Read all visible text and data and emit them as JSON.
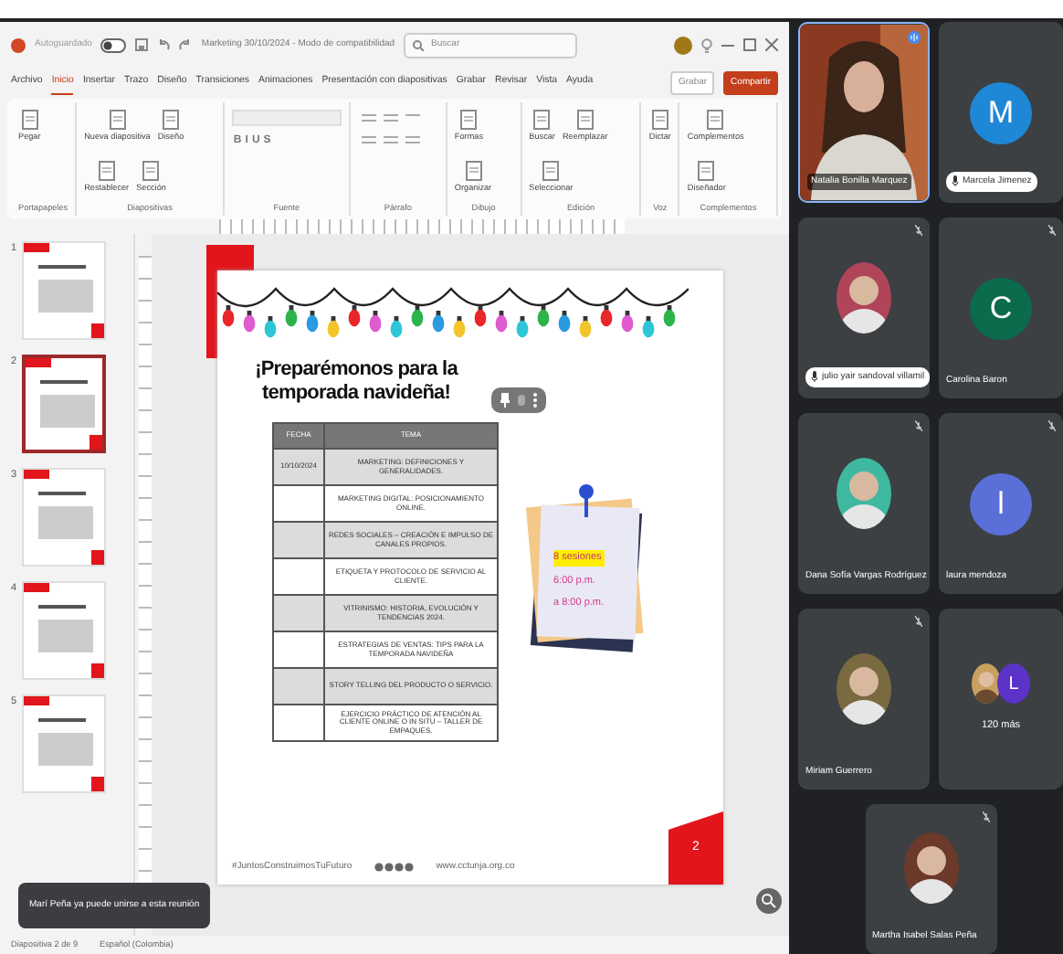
{
  "title_bar": {
    "autosave": "Autoguardado",
    "autosave_on": false,
    "document_title": "Marketing 30/10/2024 - Modo de compatibilidad",
    "search": {
      "placeholder": "Buscar"
    }
  },
  "ribbon_tabs": [
    {
      "label": "Archivo",
      "selected": false
    },
    {
      "label": "Inicio",
      "selected": true
    },
    {
      "label": "Insertar",
      "selected": false
    },
    {
      "label": "Trazo",
      "selected": false
    },
    {
      "label": "Diseño",
      "selected": false
    },
    {
      "label": "Transiciones",
      "selected": false
    },
    {
      "label": "Animaciones",
      "selected": false
    },
    {
      "label": "Presentación con diapositivas",
      "selected": false
    },
    {
      "label": "Grabar",
      "selected": false
    },
    {
      "label": "Revisar",
      "selected": false
    },
    {
      "label": "Vista",
      "selected": false
    },
    {
      "label": "Ayuda",
      "selected": false
    }
  ],
  "ribbon_actions": [
    {
      "label": "Grabar",
      "kind": "plain"
    },
    {
      "label": "Compartir",
      "kind": "primary"
    }
  ],
  "ribbon_groups": [
    {
      "label": "Portapapeles",
      "commands": [
        "Pegar"
      ]
    },
    {
      "label": "Diapositivas",
      "commands": [
        "Nueva diapositiva",
        "Diseño",
        "Restablecer",
        "Sección"
      ]
    },
    {
      "label": "Fuente",
      "commands": [
        "B",
        "I",
        "U",
        "S"
      ]
    },
    {
      "label": "Párrafo"
    },
    {
      "label": "Dibujo",
      "commands": [
        "Formas",
        "Organizar"
      ]
    },
    {
      "label": "Edición",
      "commands": [
        "Buscar",
        "Reemplazar",
        "Seleccionar"
      ]
    },
    {
      "label": "Voz",
      "commands": [
        "Dictar"
      ]
    },
    {
      "label": "Complementos",
      "commands": [
        "Complementos",
        "Diseñador"
      ]
    }
  ],
  "thumbnails": [
    {
      "number": "1",
      "selected": false
    },
    {
      "number": "2",
      "selected": true
    },
    {
      "number": "3",
      "selected": false
    },
    {
      "number": "4",
      "selected": false
    },
    {
      "number": "5",
      "selected": false
    }
  ],
  "slide": {
    "title": "¡Preparémonos para la temporada navideña!",
    "table": {
      "columns": [
        "FECHA",
        "TEMA"
      ],
      "rows": [
        [
          "10/10/2024",
          "MARKETING: DEFINICIONES Y GENERALIDADES."
        ],
        [
          "",
          "MARKETING DIGITAL: POSICIONAMIENTO ONLINE."
        ],
        [
          "",
          "REDES SOCIALES – CREACIÓN E IMPULSO DE CANALES PROPIOS."
        ],
        [
          "",
          "ETIQUETA Y PROTOCOLO DE SERVICIO AL CLIENTE."
        ],
        [
          "",
          "VITRINISMO: HISTORIA, EVOLUCIÓN Y TENDENCIAS 2024."
        ],
        [
          "",
          "ESTRATEGIAS DE VENTAS: TIPS PARA LA TEMPORADA NAVIDEÑA"
        ],
        [
          "",
          "STORY TELLING DEL PRODUCTO O SERVICIO."
        ],
        [
          "",
          "EJERCICIO PRÁCTICO DE ATENCIÓN AL CLIENTE ONLINE O IN SITU – TALLER DE EMPAQUES."
        ]
      ]
    },
    "note": [
      {
        "text": "8 sesiones",
        "highlighted": true
      },
      {
        "text": "6:00 p.m.",
        "highlighted": false
      },
      {
        "text": "a 8:00 p.m.",
        "highlighted": false
      }
    ],
    "hashtag": "#JuntosConstruimosTuFuturo",
    "website": "www.cctunja.org.co",
    "page_number": "2"
  },
  "toast": "Marí Peña ya puede unirse a esta reunión",
  "status_bar": [
    "Diapositiva 2 de 9",
    "Español (Colombia)"
  ],
  "participants": [
    {
      "name": "Natalia Bonilla Marquez",
      "kind": "video",
      "speaking": true,
      "muted": false,
      "name_pill": false
    },
    {
      "name": "Marcela Jimenez",
      "kind": "initial",
      "initial": "M",
      "color": "#1e88d6",
      "speaking": false,
      "muted": false,
      "name_pill": true
    },
    {
      "name": "julio yair sandoval villamil",
      "color": "#b0455a",
      "speaking": false,
      "muted": true,
      "name_pill": true
    },
    {
      "name": "Carolina Baron",
      "kind": "initial",
      "initial": "C",
      "color": "#0b6b4c",
      "speaking": false,
      "muted": true,
      "name_pill": false
    },
    {
      "name": "Dana Sofía Vargas Rodríguez",
      "color": "#3fb8a0",
      "speaking": false,
      "muted": true,
      "name_pill": false
    },
    {
      "name": "laura mendoza",
      "kind": "initial",
      "initial": "l",
      "color": "#5a6fd8",
      "speaking": false,
      "muted": true,
      "name_pill": false
    },
    {
      "name": "Miriam Guerrero",
      "color": "#7a6a40",
      "speaking": false,
      "muted": true,
      "name_pill": false
    },
    {
      "name": "120 más",
      "kind": "more",
      "initial": "L",
      "color": "#5b33c8",
      "speaking": false,
      "muted": false,
      "name_pill": false
    },
    {
      "name": "Martha Isabel Salas Peña",
      "color": "#6b3a2a",
      "speaking": false,
      "muted": true,
      "name_pill": false
    }
  ]
}
